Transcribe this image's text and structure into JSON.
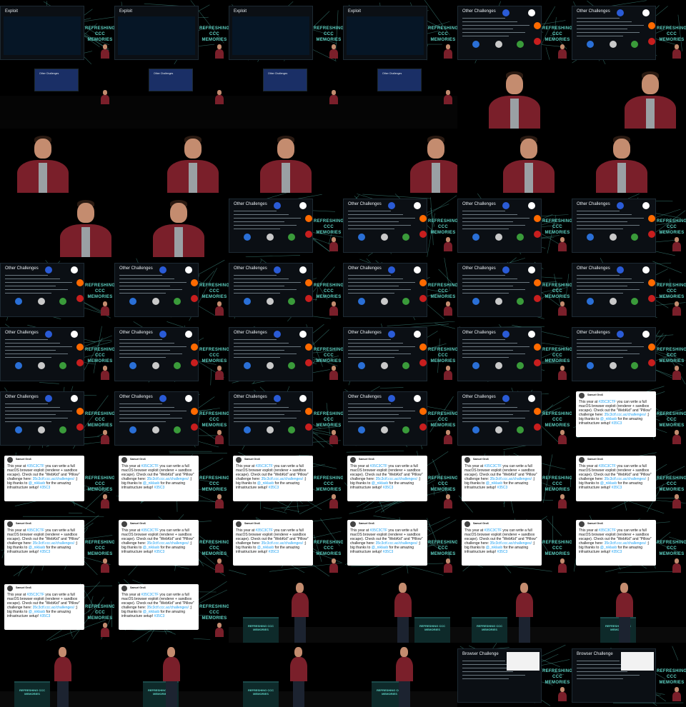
{
  "grid": {
    "columns": 6,
    "rows": 11
  },
  "colors": {
    "background": "#000000",
    "teal": "#5fd3c5",
    "maroon": "#7a1f2a",
    "slide": "#0b0f14",
    "tweet": "#ffffff",
    "link": "#1da1f2"
  },
  "logo_text": "REFRESHING CCC MEMORIES",
  "slides": {
    "exploit_title": "Exploit",
    "other_title": "Other Challenges",
    "browser_title": "Browser Challenge"
  },
  "tweet": {
    "author": "Samuel Groß",
    "text_a": "This year at ",
    "tag1": "#35C3CTF",
    "text_b": " you can write a full macOS browser exploit (renderer + sandbox escape). Check out the \"WebKid\" and \"Pillow\" challenge here: ",
    "link": "35c3ctf.ccc.ac/challenges/",
    "text_c": " ;) big thanks to ",
    "mention": "@_niklasb",
    "text_d": " for the amazing infrastructure setup! ",
    "tag2": "#35C3"
  },
  "frames": [
    "exploit",
    "exploit",
    "exploit",
    "exploit",
    "other",
    "other",
    "other-small",
    "other-small",
    "other-small",
    "other-small",
    "speaker-close",
    "speaker-close",
    "speaker-close",
    "speaker-close",
    "speaker-close",
    "speaker-close",
    "speaker-close",
    "speaker-close",
    "speaker-close",
    "speaker-close",
    "other",
    "other",
    "other",
    "other",
    "other",
    "other",
    "other",
    "other",
    "other",
    "other",
    "other",
    "other",
    "other",
    "other",
    "other",
    "other",
    "other",
    "other",
    "other",
    "other",
    "other",
    "tweet",
    "tweet",
    "tweet",
    "tweet",
    "tweet",
    "tweet",
    "tweet",
    "tweet",
    "tweet",
    "tweet",
    "tweet",
    "tweet",
    "tweet",
    "tweet",
    "tweet",
    "stage",
    "stage",
    "stage",
    "stage",
    "stage",
    "stage",
    "stage",
    "stage",
    "browser",
    "browser"
  ]
}
